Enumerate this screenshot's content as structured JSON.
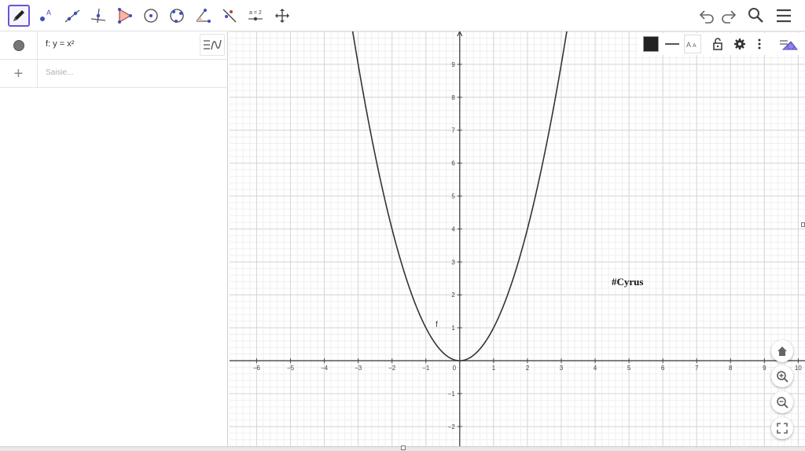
{
  "toolbar": {
    "tools": [
      {
        "name": "pen-tool",
        "active": true
      },
      {
        "name": "point-tool"
      },
      {
        "name": "line-tool"
      },
      {
        "name": "perpendicular-line-tool"
      },
      {
        "name": "polygon-tool"
      },
      {
        "name": "circle-center-point-tool"
      },
      {
        "name": "circle-three-points-tool"
      },
      {
        "name": "angle-tool"
      },
      {
        "name": "reflect-tool"
      },
      {
        "name": "slider-tool",
        "label": "a = 2"
      },
      {
        "name": "move-graphics-tool"
      }
    ],
    "right": [
      "undo-icon",
      "redo-icon",
      "search-icon",
      "menu-icon"
    ]
  },
  "algebra": {
    "function_definition": "f: y = x²",
    "input_placeholder": "Saisie..."
  },
  "graphics": {
    "text_annotation": "#Cyrus",
    "curve_label": "f",
    "style_bar": [
      "color-swatch",
      "line-style",
      "label-style",
      "lock-icon",
      "gear-icon",
      "more-icon",
      "graphics-view-icon"
    ],
    "zoom_buttons": [
      "home-icon",
      "zoom-in-icon",
      "zoom-out-icon",
      "fullscreen-icon"
    ],
    "accent_color": "#6557d2",
    "curve_color": "#333333"
  },
  "chart_data": {
    "type": "line",
    "series": [
      {
        "name": "f",
        "expression": "y = x^2",
        "x": [
          -3.2,
          -3,
          -2.5,
          -2,
          -1.5,
          -1,
          -0.5,
          0,
          0.5,
          1,
          1.5,
          2,
          2.5,
          3,
          3.2
        ],
        "y": [
          10.24,
          9,
          6.25,
          4,
          2.25,
          1,
          0.25,
          0,
          0.25,
          1,
          2.25,
          4,
          6.25,
          9,
          10.24
        ]
      }
    ],
    "xlim": [
      -6.8,
      10.2
    ],
    "ylim": [
      -2.6,
      10
    ],
    "x_ticks": [
      -6,
      -5,
      -4,
      -3,
      -2,
      -1,
      0,
      1,
      2,
      3,
      4,
      5,
      6,
      7,
      8,
      9,
      10
    ],
    "x_tick_labels": [
      "−6",
      "−5",
      "−4",
      "−3",
      "−2",
      "−1",
      "0",
      "1",
      "2",
      "3",
      "4",
      "5",
      "6",
      "7",
      "8",
      "9",
      "10"
    ],
    "y_ticks": [
      -2,
      -1,
      1,
      2,
      3,
      4,
      5,
      6,
      7,
      8,
      9
    ],
    "y_tick_labels": [
      "−2",
      "−1",
      "1",
      "2",
      "3",
      "4",
      "5",
      "6",
      "7",
      "8",
      "9"
    ],
    "grid": true,
    "minor_grid": true
  }
}
